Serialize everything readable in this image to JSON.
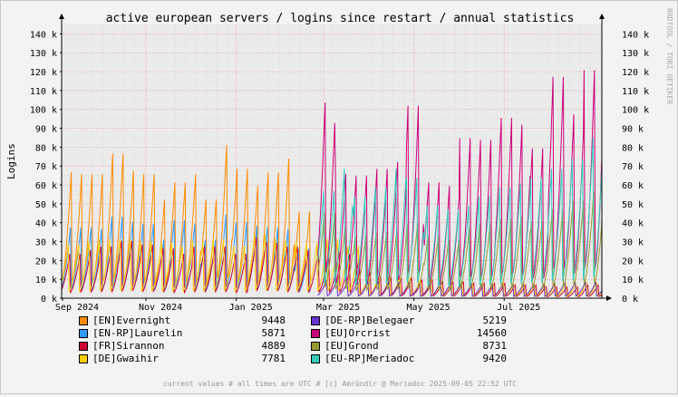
{
  "title": "active european servers / logins since restart / annual statistics",
  "side_credit": "RRDTOOL / TOBI OETIKER",
  "footer": "current values # all times are UTC # [c] Amrûndir @ Meriadoc 2025-09-05 22:52 UTC",
  "colors": {
    "background": "#f3f3f3",
    "plot_bg": "#ebebeb",
    "grid": "#e8a0a0"
  },
  "chart_data": {
    "type": "line",
    "title": "active european servers / logins since restart / annual statistics",
    "ylabel": "Logins",
    "xlabel": "",
    "ylim": [
      0,
      145000
    ],
    "y_ticks": [
      0,
      10000,
      20000,
      30000,
      40000,
      50000,
      60000,
      70000,
      80000,
      90000,
      100000,
      110000,
      120000,
      130000,
      140000
    ],
    "y_tick_labels": [
      "0 k",
      "10 k",
      "20 k",
      "30 k",
      "40 k",
      "50 k",
      "60 k",
      "70 k",
      "80 k",
      "90 k",
      "100 k",
      "110 k",
      "120 k",
      "130 k",
      "140 k"
    ],
    "x_range": [
      "2024-09-05",
      "2025-09-05"
    ],
    "x_ticks": [
      {
        "date": "2024-09-01",
        "label": "Sep 2024"
      },
      {
        "date": "2024-11-01",
        "label": "Nov 2024"
      },
      {
        "date": "2025-01-01",
        "label": "Jan 2025"
      },
      {
        "date": "2025-03-01",
        "label": "Mar 2025"
      },
      {
        "date": "2025-05-01",
        "label": "May 2025"
      },
      {
        "date": "2025-07-01",
        "label": "Jul 2025"
      }
    ],
    "grid": true,
    "series": [
      {
        "name": "[EN]Evernight",
        "color": "#ff8c00",
        "current": 9448,
        "active": [
          "2024-09-05",
          "2025-02-20"
        ],
        "cycle_days": 7,
        "peaks": [
          74,
          73,
          73,
          85,
          75,
          73,
          58,
          68,
          73,
          58,
          90,
          76,
          66,
          74,
          82,
          51
        ]
      },
      {
        "name": "[EN-RP]Laurelin",
        "color": "#3399ff",
        "current": 5871,
        "active": [
          "2024-09-05",
          "2025-02-20"
        ],
        "cycle_days": 7,
        "peaks": [
          40,
          40,
          39,
          46,
          43,
          42,
          33,
          44,
          42,
          33,
          47,
          43,
          41,
          40,
          39,
          28
        ]
      },
      {
        "name": "[FR]Sirannon",
        "color": "#cc0033",
        "current": 4889,
        "active": [
          "2024-09-05",
          "2025-09-05"
        ],
        "cycle_days": 7,
        "peaks": [
          24,
          26,
          28,
          31,
          29,
          27,
          24,
          28,
          28,
          24,
          33,
          30,
          28,
          26,
          25,
          24,
          14,
          12,
          11,
          10,
          9,
          9,
          8,
          8,
          7,
          7,
          6,
          6,
          7
        ]
      },
      {
        "name": "[DE]Gwaihir",
        "color": "#ffcc00",
        "current": 7781,
        "active": [
          "2024-09-05",
          "2025-09-05"
        ],
        "cycle_days": 7,
        "peaks": [
          31,
          33,
          34,
          34,
          33,
          32,
          30,
          33,
          34,
          30,
          37,
          34,
          33,
          32,
          34,
          30,
          14,
          12,
          12,
          11,
          10,
          10,
          9,
          9,
          8,
          8,
          8,
          8,
          9
        ]
      },
      {
        "name": "[DE-RP]Belegaer",
        "color": "#6633cc",
        "current": 5219,
        "active": [
          "2025-02-25",
          "2025-09-05"
        ],
        "cycle_days": 7,
        "peaks": [
          10,
          9,
          9,
          9,
          8,
          9,
          8,
          8,
          8,
          8,
          9,
          9
        ]
      },
      {
        "name": "[EU]Orcrist",
        "color": "#cc0077",
        "current": 14560,
        "active": [
          "2025-02-25",
          "2025-09-05"
        ],
        "cycle_days": 7,
        "peaks": [
          115,
          73,
          72,
          76,
          80,
          113,
          68,
          66,
          94,
          93,
          106,
          102,
          88,
          130,
          108,
          134
        ]
      },
      {
        "name": "[EU]Grond",
        "color": "#999933",
        "current": 8731,
        "active": [
          "2025-02-25",
          "2025-09-05"
        ],
        "cycle_days": 7,
        "peaks": [
          48,
          40,
          35,
          37,
          38,
          42,
          35,
          33,
          40,
          42,
          45,
          46,
          43,
          50,
          55,
          60
        ]
      },
      {
        "name": "[EU-RP]Meriadoc",
        "color": "#33ccbb",
        "current": 9420,
        "active": [
          "2025-02-25",
          "2025-09-05"
        ],
        "cycle_days": 7,
        "peaks": [
          58,
          70,
          55,
          60,
          70,
          65,
          50,
          48,
          50,
          55,
          60,
          62,
          65,
          70,
          75,
          87
        ]
      }
    ],
    "legend_placement": "bottom"
  }
}
